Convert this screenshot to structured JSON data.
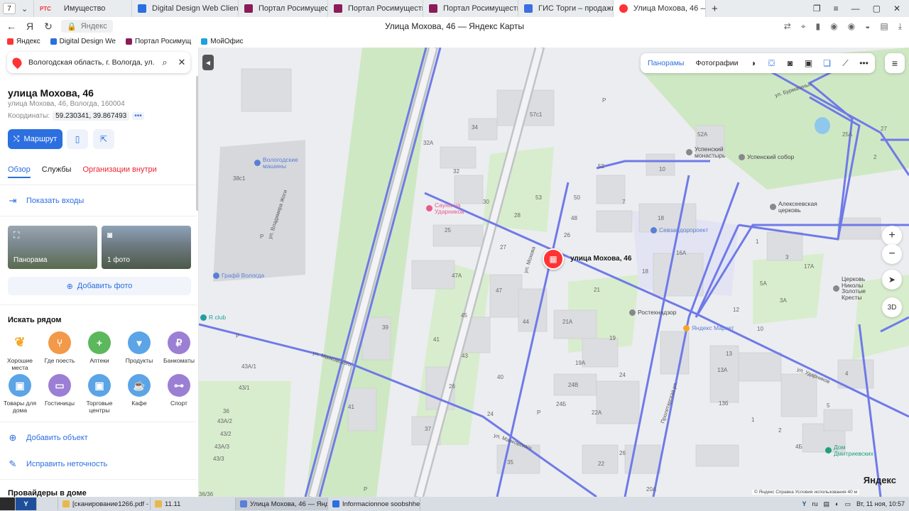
{
  "browser": {
    "tab_count": "7",
    "tabs": [
      {
        "label": "Имущество",
        "color": "#e33"
      },
      {
        "label": "Digital Design Web Client",
        "color": "#2b6fe0"
      },
      {
        "label": "Портал Росимущества",
        "color": "#8a1c5a"
      },
      {
        "label": "Портал Росимущества",
        "color": "#8a1c5a"
      },
      {
        "label": "Портал Росимущества",
        "color": "#8a1c5a"
      },
      {
        "label": "ГИС Торги – продажи гос",
        "color": "#3d6fe0"
      },
      {
        "label": "Улица Мохова, 46 — Ян",
        "color": "#f33"
      }
    ],
    "rts_label": "РТС",
    "address_text": "Яндекс",
    "page_title": "Улица Мохова, 46 — Яндекс Карты",
    "bookmarks": [
      {
        "label": "Яндекс",
        "color": "#f33"
      },
      {
        "label": "Digital Design We",
        "color": "#2b6fe0"
      },
      {
        "label": "Портал Росимущ",
        "color": "#8a1c5a"
      },
      {
        "label": "МойОфис",
        "color": "#1fa0e0"
      }
    ]
  },
  "sidebar": {
    "search_value": "Вологодская область, г. Вологда, ул.",
    "title": "улица Мохова, 46",
    "address": "улица Мохова, 46, Вологда, 160004",
    "coords_label": "Координаты:",
    "coords_value": "59.230341, 39.867493",
    "route_label": "Маршрут",
    "tabs": [
      "Обзор",
      "Службы",
      "Организации внутри"
    ],
    "show_entrances": "Показать входы",
    "photos": [
      {
        "label": "Панорама"
      },
      {
        "label": "1 фото"
      }
    ],
    "add_photo": "Добавить фото",
    "nearby_title": "Искать рядом",
    "categories_row1": [
      {
        "label": "Хорошие места",
        "color": "#f5a623"
      },
      {
        "label": "Где поесть",
        "color": "#f2994a"
      },
      {
        "label": "Аптеки",
        "color": "#5cb85c"
      },
      {
        "label": "Продукты",
        "color": "#5ba4e6"
      },
      {
        "label": "Банкоматы",
        "color": "#9b7fd4"
      }
    ],
    "categories_row2": [
      {
        "label": "Товары для дома",
        "color": "#5ba4e6"
      },
      {
        "label": "Гостиницы",
        "color": "#9b7fd4"
      },
      {
        "label": "Торговые центры",
        "color": "#5ba4e6"
      },
      {
        "label": "Кафе",
        "color": "#5ba4e6"
      },
      {
        "label": "Спорт",
        "color": "#9b7fd4"
      }
    ],
    "add_object": "Добавить объект",
    "fix_error": "Исправить неточность",
    "providers": "Провайдеры в доме"
  },
  "map": {
    "toolbar": {
      "panoramas": "Панорамы",
      "photos": "Фотографии"
    },
    "marker_label": "улица Мохова, 46",
    "pois": [
      {
        "label": "Вологодские машины",
        "color": "#5b7fd6"
      },
      {
        "label": "Сауна на Ударников",
        "color": "#e85a8c"
      },
      {
        "label": "Севзапдорпроект",
        "color": "#5b7fd6"
      },
      {
        "label": "Успенский монастырь",
        "color": "#888"
      },
      {
        "label": "Успенский собор",
        "color": "#888"
      },
      {
        "label": "Алексеевская церковь",
        "color": "#888"
      },
      {
        "label": "Ростехнадзор",
        "color": "#888"
      },
      {
        "label": "Яндекс Маркет",
        "color": "#f5a623"
      },
      {
        "label": "Графй Вологда",
        "color": "#5b7fd6"
      },
      {
        "label": "R club",
        "color": "#1fa0a0"
      },
      {
        "label": "Церковь Николы Золотые Кресты",
        "color": "#888"
      },
      {
        "label": "Дом Дмитриевских",
        "color": "#1fa07a"
      }
    ],
    "streets": [
      "ул. Мохова",
      "ул. Маяковского",
      "ул. Ударников",
      "ул. Бурмагиных",
      "Пролетарская ул.",
      "ул. Владимира Жоги",
      "ул. Маяковского"
    ],
    "brand": "Яндекс",
    "copyright": "© Яндекс  Справка  Условия использования",
    "scale": "40 м",
    "view3d": "3D"
  },
  "taskbar": {
    "items": [
      {
        "label": "[сканирование1266.pdf - ...",
        "color": "#e8b84a"
      },
      {
        "label": "11.11",
        "color": "#e8b84a"
      },
      {
        "label": "Улица Мохова, 46 — Янд...",
        "color": "#5b7fd6"
      },
      {
        "label": "Informacionnoe soobshhe...",
        "color": "#2b6fe0"
      }
    ],
    "lang": "ru",
    "datetime": "Вт, 11 ноя, 10:57"
  }
}
